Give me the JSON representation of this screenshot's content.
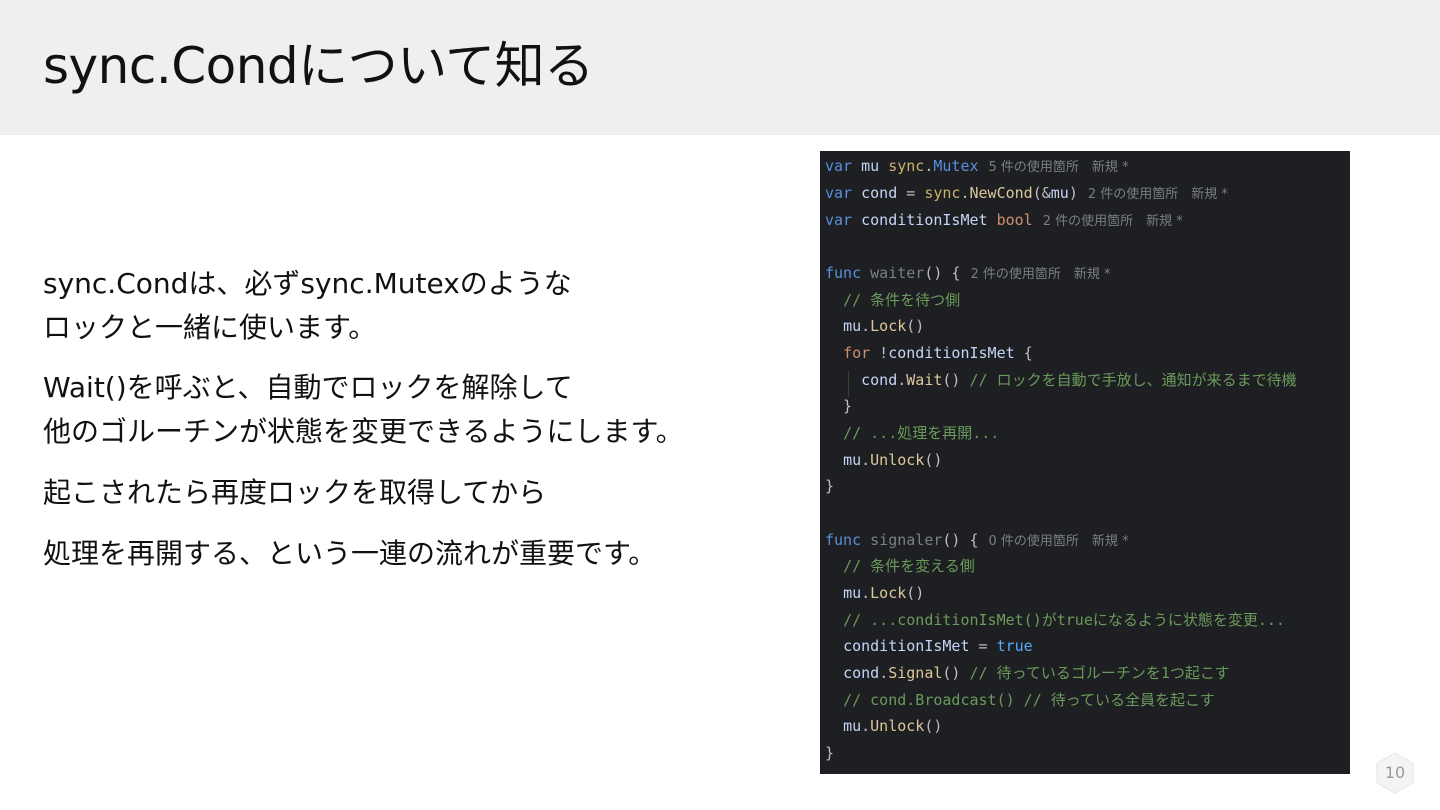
{
  "slide": {
    "title": "sync.Condについて知る",
    "body": {
      "p1_line1": "sync.Condは、必ずsync.Mutexのような",
      "p1_line2": "ロックと一緒に使います。",
      "p2_line1": "Wait()を呼ぶと、自動でロックを解除して",
      "p2_line2": "他のゴルーチンが状態を変更できるようにします。",
      "p3": "起こされたら再度ロックを取得してから",
      "p4": "処理を再開する、という一連の流れが重要です。"
    },
    "page_number": "10"
  },
  "code": {
    "usage_hints": {
      "mu": "5 件の使用箇所　新規 *",
      "cond": "2 件の使用箇所　新規 *",
      "conditionIsMet": "2 件の使用箇所　新規 *",
      "waiter": "2 件の使用箇所　新規 *",
      "signaler": "0 件の使用箇所　新規 *"
    },
    "comments": {
      "waiter_side": "// 条件を待つ側",
      "wait_note": "// ロックを自動で手放し、通知が来るまで待機",
      "resume": "// ...処理を再開...",
      "signaler_side": "// 条件を変える側",
      "change_state": "// ...conditionIsMet()がtrueになるように状態を変更...",
      "signal_note": "// 待っているゴルーチンを1つ起こす",
      "broadcast": "// cond.Broadcast() // 待っている全員を起こす"
    }
  },
  "colors": {
    "header_bg": "#efefef",
    "code_bg": "#1e1f22",
    "keyword": "#5a8fdb",
    "comment": "#6a9a5b",
    "type": "#c9b268"
  }
}
